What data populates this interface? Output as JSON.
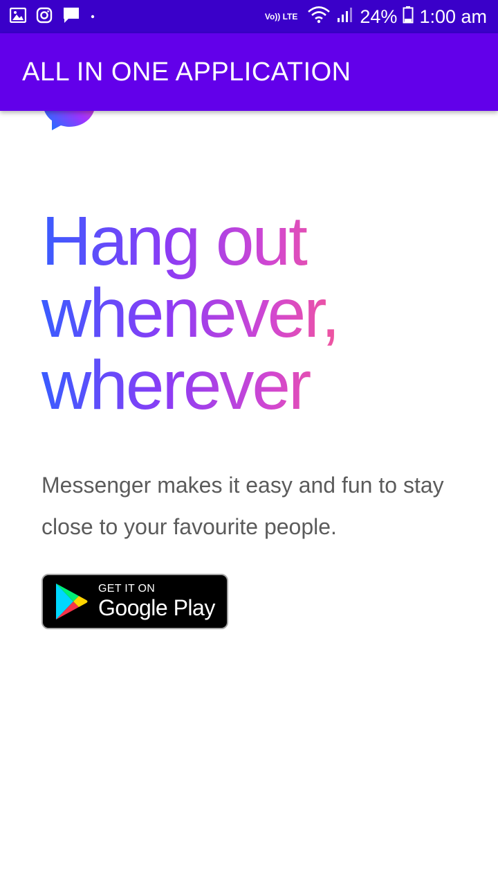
{
  "status_bar": {
    "icons_left": [
      "gallery-icon",
      "instagram-icon",
      "message-icon",
      "dot-icon"
    ],
    "network": "Vo)) LTE",
    "battery": "24%",
    "time": "1:00 am"
  },
  "app_bar": {
    "title": "ALL IN ONE APPLICATION",
    "color": "#6200ea"
  },
  "hero": {
    "logo": "messenger-icon",
    "headline_lines": [
      "Hang out",
      "whenever,",
      "wherever"
    ],
    "description": "Messenger makes it easy and fun to stay close to your favourite people."
  },
  "store_badge": {
    "small_text": "GET IT ON",
    "large_text": "Google Play",
    "icon": "google-play-icon"
  }
}
